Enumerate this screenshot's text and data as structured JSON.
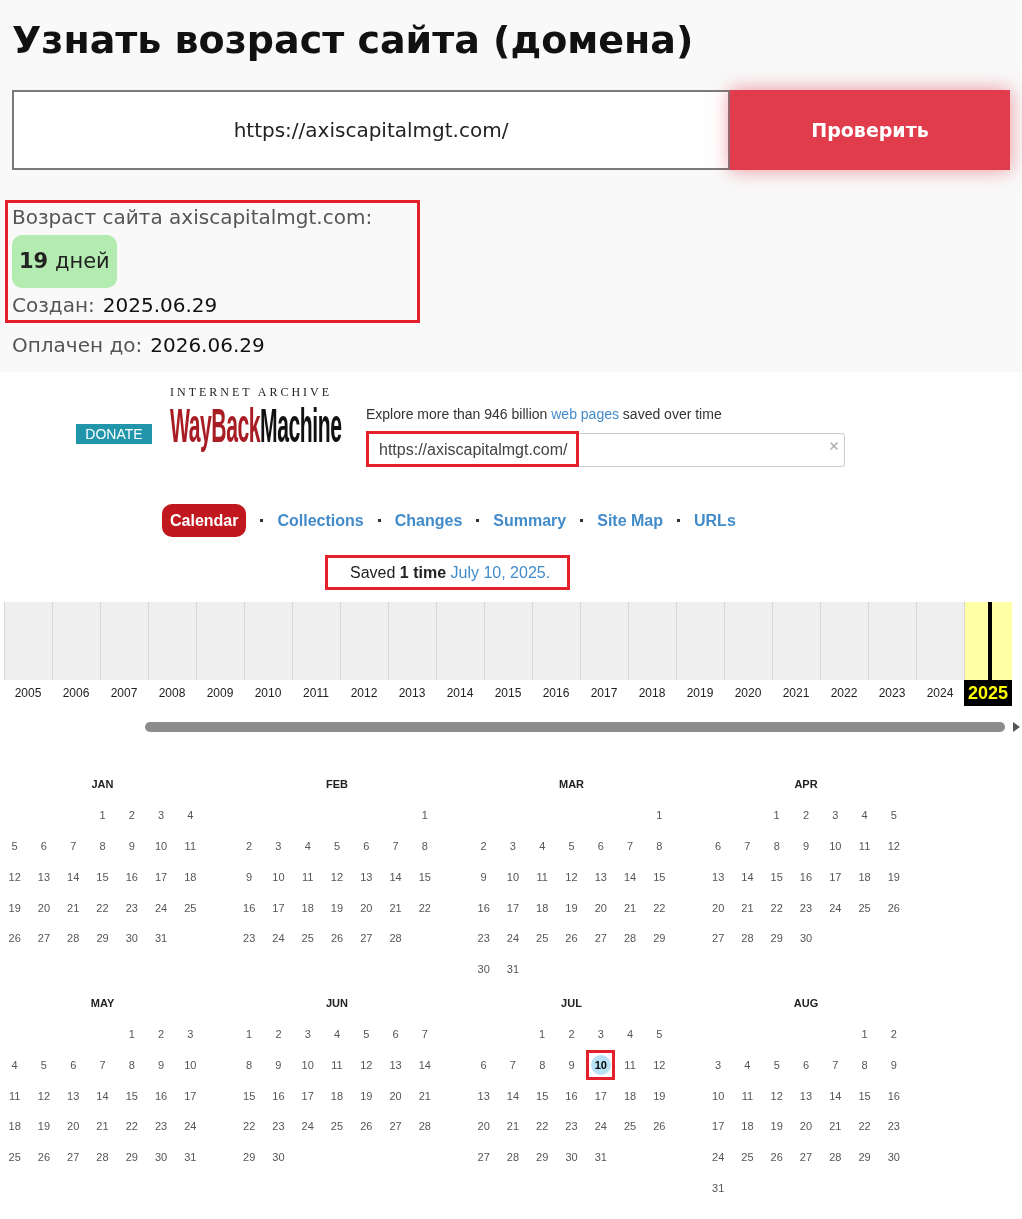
{
  "title": "Узнать возраст сайта (домена)",
  "check_form": {
    "value": "https://axiscapitalmgt.com/",
    "button": "Проверить"
  },
  "result": {
    "highlighted": true,
    "label": "Возраст сайта axiscapitalmgt.com:",
    "age": "**19** дней",
    "created_label": "Создан:",
    "created": "2025.06.29"
  },
  "paid": {
    "label": "Оплачен до:",
    "value": "2026.06.29"
  },
  "wayback": {
    "donate": "DONATE",
    "logo": {
      "caption": "INTERNET ARCHIVE",
      "word_1": "WayBack",
      "word_2": "Machine"
    },
    "tagline": {
      "before": "Explore more than 946 billion",
      "link": "web pages",
      "after": "saved over time"
    },
    "search": {
      "value": "https://axiscapitalmgt.com/",
      "highlighted": true
    },
    "nav": [
      {
        "label": "Calendar",
        "selected": true
      },
      {
        "label": "Collections",
        "selected": false
      },
      {
        "label": "Changes",
        "selected": false
      },
      {
        "label": "Summary",
        "selected": false
      },
      {
        "label": "Site Map",
        "selected": false
      },
      {
        "label": "URLs",
        "selected": false
      }
    ],
    "saved": {
      "summary": "Saved **1 time**",
      "date_link": "July 10, 2025.",
      "highlighted": true
    }
  },
  "timeline": {
    "years": [
      {
        "label": "2005",
        "selected": false,
        "has_captures": false
      },
      {
        "label": "2006",
        "selected": false,
        "has_captures": false
      },
      {
        "label": "2007",
        "selected": false,
        "has_captures": false
      },
      {
        "label": "2008",
        "selected": false,
        "has_captures": false
      },
      {
        "label": "2009",
        "selected": false,
        "has_captures": false
      },
      {
        "label": "2010",
        "selected": false,
        "has_captures": false
      },
      {
        "label": "2011",
        "selected": false,
        "has_captures": false
      },
      {
        "label": "2012",
        "selected": false,
        "has_captures": false
      },
      {
        "label": "2013",
        "selected": false,
        "has_captures": false
      },
      {
        "label": "2014",
        "selected": false,
        "has_captures": false
      },
      {
        "label": "2015",
        "selected": false,
        "has_captures": false
      },
      {
        "label": "2016",
        "selected": false,
        "has_captures": false
      },
      {
        "label": "2017",
        "selected": false,
        "has_captures": false
      },
      {
        "label": "2018",
        "selected": false,
        "has_captures": false
      },
      {
        "label": "2019",
        "selected": false,
        "has_captures": false
      },
      {
        "label": "2020",
        "selected": false,
        "has_captures": false
      },
      {
        "label": "2021",
        "selected": false,
        "has_captures": false
      },
      {
        "label": "2022",
        "selected": false,
        "has_captures": false
      },
      {
        "label": "2023",
        "selected": false,
        "has_captures": false
      },
      {
        "label": "2024",
        "selected": false,
        "has_captures": false
      },
      {
        "label": "2025",
        "selected": true,
        "has_captures": true
      }
    ]
  },
  "calendar": {
    "months": [
      {
        "name": "JAN",
        "weeks": [
          [
            {
              "day": "1",
              "saved": false,
              "highlighted": false
            },
            {
              "day": "2",
              "saved": false,
              "highlighted": false
            },
            {
              "day": "3",
              "saved": false,
              "highlighted": false
            },
            {
              "day": "4",
              "saved": false,
              "highlighted": false
            }
          ],
          [
            {
              "day": "5",
              "saved": false,
              "highlighted": false
            },
            {
              "day": "6",
              "saved": false,
              "highlighted": false
            },
            {
              "day": "7",
              "saved": false,
              "highlighted": false
            },
            {
              "day": "8",
              "saved": false,
              "highlighted": false
            },
            {
              "day": "9",
              "saved": false,
              "highlighted": false
            },
            {
              "day": "10",
              "saved": false,
              "highlighted": false
            },
            {
              "day": "11",
              "saved": false,
              "highlighted": false
            }
          ],
          [
            {
              "day": "12",
              "saved": false,
              "highlighted": false
            },
            {
              "day": "13",
              "saved": false,
              "highlighted": false
            },
            {
              "day": "14",
              "saved": false,
              "highlighted": false
            },
            {
              "day": "15",
              "saved": false,
              "highlighted": false
            },
            {
              "day": "16",
              "saved": false,
              "highlighted": false
            },
            {
              "day": "17",
              "saved": false,
              "highlighted": false
            },
            {
              "day": "18",
              "saved": false,
              "highlighted": false
            }
          ],
          [
            {
              "day": "19",
              "saved": false,
              "highlighted": false
            },
            {
              "day": "20",
              "saved": false,
              "highlighted": false
            },
            {
              "day": "21",
              "saved": false,
              "highlighted": false
            },
            {
              "day": "22",
              "saved": false,
              "highlighted": false
            },
            {
              "day": "23",
              "saved": false,
              "highlighted": false
            },
            {
              "day": "24",
              "saved": false,
              "highlighted": false
            },
            {
              "day": "25",
              "saved": false,
              "highlighted": false
            }
          ],
          [
            {
              "day": "26",
              "saved": false,
              "highlighted": false
            },
            {
              "day": "27",
              "saved": false,
              "highlighted": false
            },
            {
              "day": "28",
              "saved": false,
              "highlighted": false
            },
            {
              "day": "29",
              "saved": false,
              "highlighted": false
            },
            {
              "day": "30",
              "saved": false,
              "highlighted": false
            },
            {
              "day": "31",
              "saved": false,
              "highlighted": false
            }
          ]
        ]
      },
      {
        "name": "FEB",
        "weeks": [
          [
            {
              "day": "1",
              "saved": false,
              "highlighted": false
            }
          ],
          [
            {
              "day": "2",
              "saved": false,
              "highlighted": false
            },
            {
              "day": "3",
              "saved": false,
              "highlighted": false
            },
            {
              "day": "4",
              "saved": false,
              "highlighted": false
            },
            {
              "day": "5",
              "saved": false,
              "highlighted": false
            },
            {
              "day": "6",
              "saved": false,
              "highlighted": false
            },
            {
              "day": "7",
              "saved": false,
              "highlighted": false
            },
            {
              "day": "8",
              "saved": false,
              "highlighted": false
            }
          ],
          [
            {
              "day": "9",
              "saved": false,
              "highlighted": false
            },
            {
              "day": "10",
              "saved": false,
              "highlighted": false
            },
            {
              "day": "11",
              "saved": false,
              "highlighted": false
            },
            {
              "day": "12",
              "saved": false,
              "highlighted": false
            },
            {
              "day": "13",
              "saved": false,
              "highlighted": false
            },
            {
              "day": "14",
              "saved": false,
              "highlighted": false
            },
            {
              "day": "15",
              "saved": false,
              "highlighted": false
            }
          ],
          [
            {
              "day": "16",
              "saved": false,
              "highlighted": false
            },
            {
              "day": "17",
              "saved": false,
              "highlighted": false
            },
            {
              "day": "18",
              "saved": false,
              "highlighted": false
            },
            {
              "day": "19",
              "saved": false,
              "highlighted": false
            },
            {
              "day": "20",
              "saved": false,
              "highlighted": false
            },
            {
              "day": "21",
              "saved": false,
              "highlighted": false
            },
            {
              "day": "22",
              "saved": false,
              "highlighted": false
            }
          ],
          [
            {
              "day": "23",
              "saved": false,
              "highlighted": false
            },
            {
              "day": "24",
              "saved": false,
              "highlighted": false
            },
            {
              "day": "25",
              "saved": false,
              "highlighted": false
            },
            {
              "day": "26",
              "saved": false,
              "highlighted": false
            },
            {
              "day": "27",
              "saved": false,
              "highlighted": false
            },
            {
              "day": "28",
              "saved": false,
              "highlighted": false
            }
          ]
        ]
      },
      {
        "name": "MAR",
        "weeks": [
          [
            {
              "day": "1",
              "saved": false,
              "highlighted": false
            }
          ],
          [
            {
              "day": "2",
              "saved": false,
              "highlighted": false
            },
            {
              "day": "3",
              "saved": false,
              "highlighted": false
            },
            {
              "day": "4",
              "saved": false,
              "highlighted": false
            },
            {
              "day": "5",
              "saved": false,
              "highlighted": false
            },
            {
              "day": "6",
              "saved": false,
              "highlighted": false
            },
            {
              "day": "7",
              "saved": false,
              "highlighted": false
            },
            {
              "day": "8",
              "saved": false,
              "highlighted": false
            }
          ],
          [
            {
              "day": "9",
              "saved": false,
              "highlighted": false
            },
            {
              "day": "10",
              "saved": false,
              "highlighted": false
            },
            {
              "day": "11",
              "saved": false,
              "highlighted": false
            },
            {
              "day": "12",
              "saved": false,
              "highlighted": false
            },
            {
              "day": "13",
              "saved": false,
              "highlighted": false
            },
            {
              "day": "14",
              "saved": false,
              "highlighted": false
            },
            {
              "day": "15",
              "saved": false,
              "highlighted": false
            }
          ],
          [
            {
              "day": "16",
              "saved": false,
              "highlighted": false
            },
            {
              "day": "17",
              "saved": false,
              "highlighted": false
            },
            {
              "day": "18",
              "saved": false,
              "highlighted": false
            },
            {
              "day": "19",
              "saved": false,
              "highlighted": false
            },
            {
              "day": "20",
              "saved": false,
              "highlighted": false
            },
            {
              "day": "21",
              "saved": false,
              "highlighted": false
            },
            {
              "day": "22",
              "saved": false,
              "highlighted": false
            }
          ],
          [
            {
              "day": "23",
              "saved": false,
              "highlighted": false
            },
            {
              "day": "24",
              "saved": false,
              "highlighted": false
            },
            {
              "day": "25",
              "saved": false,
              "highlighted": false
            },
            {
              "day": "26",
              "saved": false,
              "highlighted": false
            },
            {
              "day": "27",
              "saved": false,
              "highlighted": false
            },
            {
              "day": "28",
              "saved": false,
              "highlighted": false
            },
            {
              "day": "29",
              "saved": false,
              "highlighted": false
            }
          ],
          [
            {
              "day": "30",
              "saved": false,
              "highlighted": false
            },
            {
              "day": "31",
              "saved": false,
              "highlighted": false
            }
          ]
        ]
      },
      {
        "name": "APR",
        "weeks": [
          [
            {
              "day": "1",
              "saved": false,
              "highlighted": false
            },
            {
              "day": "2",
              "saved": false,
              "highlighted": false
            },
            {
              "day": "3",
              "saved": false,
              "highlighted": false
            },
            {
              "day": "4",
              "saved": false,
              "highlighted": false
            },
            {
              "day": "5",
              "saved": false,
              "highlighted": false
            }
          ],
          [
            {
              "day": "6",
              "saved": false,
              "highlighted": false
            },
            {
              "day": "7",
              "saved": false,
              "highlighted": false
            },
            {
              "day": "8",
              "saved": false,
              "highlighted": false
            },
            {
              "day": "9",
              "saved": false,
              "highlighted": false
            },
            {
              "day": "10",
              "saved": false,
              "highlighted": false
            },
            {
              "day": "11",
              "saved": false,
              "highlighted": false
            },
            {
              "day": "12",
              "saved": false,
              "highlighted": false
            }
          ],
          [
            {
              "day": "13",
              "saved": false,
              "highlighted": false
            },
            {
              "day": "14",
              "saved": false,
              "highlighted": false
            },
            {
              "day": "15",
              "saved": false,
              "highlighted": false
            },
            {
              "day": "16",
              "saved": false,
              "highlighted": false
            },
            {
              "day": "17",
              "saved": false,
              "highlighted": false
            },
            {
              "day": "18",
              "saved": false,
              "highlighted": false
            },
            {
              "day": "19",
              "saved": false,
              "highlighted": false
            }
          ],
          [
            {
              "day": "20",
              "saved": false,
              "highlighted": false
            },
            {
              "day": "21",
              "saved": false,
              "highlighted": false
            },
            {
              "day": "22",
              "saved": false,
              "highlighted": false
            },
            {
              "day": "23",
              "saved": false,
              "highlighted": false
            },
            {
              "day": "24",
              "saved": false,
              "highlighted": false
            },
            {
              "day": "25",
              "saved": false,
              "highlighted": false
            },
            {
              "day": "26",
              "saved": false,
              "highlighted": false
            }
          ],
          [
            {
              "day": "27",
              "saved": false,
              "highlighted": false
            },
            {
              "day": "28",
              "saved": false,
              "highlighted": false
            },
            {
              "day": "29",
              "saved": false,
              "highlighted": false
            },
            {
              "day": "30",
              "saved": false,
              "highlighted": false
            }
          ]
        ]
      },
      {
        "name": "MAY",
        "weeks": [
          [
            {
              "day": "1",
              "saved": false,
              "highlighted": false
            },
            {
              "day": "2",
              "saved": false,
              "highlighted": false
            },
            {
              "day": "3",
              "saved": false,
              "highlighted": false
            }
          ],
          [
            {
              "day": "4",
              "saved": false,
              "highlighted": false
            },
            {
              "day": "5",
              "saved": false,
              "highlighted": false
            },
            {
              "day": "6",
              "saved": false,
              "highlighted": false
            },
            {
              "day": "7",
              "saved": false,
              "highlighted": false
            },
            {
              "day": "8",
              "saved": false,
              "highlighted": false
            },
            {
              "day": "9",
              "saved": false,
              "highlighted": false
            },
            {
              "day": "10",
              "saved": false,
              "highlighted": false
            }
          ],
          [
            {
              "day": "11",
              "saved": false,
              "highlighted": false
            },
            {
              "day": "12",
              "saved": false,
              "highlighted": false
            },
            {
              "day": "13",
              "saved": false,
              "highlighted": false
            },
            {
              "day": "14",
              "saved": false,
              "highlighted": false
            },
            {
              "day": "15",
              "saved": false,
              "highlighted": false
            },
            {
              "day": "16",
              "saved": false,
              "highlighted": false
            },
            {
              "day": "17",
              "saved": false,
              "highlighted": false
            }
          ],
          [
            {
              "day": "18",
              "saved": false,
              "highlighted": false
            },
            {
              "day": "19",
              "saved": false,
              "highlighted": false
            },
            {
              "day": "20",
              "saved": false,
              "highlighted": false
            },
            {
              "day": "21",
              "saved": false,
              "highlighted": false
            },
            {
              "day": "22",
              "saved": false,
              "highlighted": false
            },
            {
              "day": "23",
              "saved": false,
              "highlighted": false
            },
            {
              "day": "24",
              "saved": false,
              "highlighted": false
            }
          ],
          [
            {
              "day": "25",
              "saved": false,
              "highlighted": false
            },
            {
              "day": "26",
              "saved": false,
              "highlighted": false
            },
            {
              "day": "27",
              "saved": false,
              "highlighted": false
            },
            {
              "day": "28",
              "saved": false,
              "highlighted": false
            },
            {
              "day": "29",
              "saved": false,
              "highlighted": false
            },
            {
              "day": "30",
              "saved": false,
              "highlighted": false
            },
            {
              "day": "31",
              "saved": false,
              "highlighted": false
            }
          ]
        ]
      },
      {
        "name": "JUN",
        "weeks": [
          [
            {
              "day": "1",
              "saved": false,
              "highlighted": false
            },
            {
              "day": "2",
              "saved": false,
              "highlighted": false
            },
            {
              "day": "3",
              "saved": false,
              "highlighted": false
            },
            {
              "day": "4",
              "saved": false,
              "highlighted": false
            },
            {
              "day": "5",
              "saved": false,
              "highlighted": false
            },
            {
              "day": "6",
              "saved": false,
              "highlighted": false
            },
            {
              "day": "7",
              "saved": false,
              "highlighted": false
            }
          ],
          [
            {
              "day": "8",
              "saved": false,
              "highlighted": false
            },
            {
              "day": "9",
              "saved": false,
              "highlighted": false
            },
            {
              "day": "10",
              "saved": false,
              "highlighted": false
            },
            {
              "day": "11",
              "saved": false,
              "highlighted": false
            },
            {
              "day": "12",
              "saved": false,
              "highlighted": false
            },
            {
              "day": "13",
              "saved": false,
              "highlighted": false
            },
            {
              "day": "14",
              "saved": false,
              "highlighted": false
            }
          ],
          [
            {
              "day": "15",
              "saved": false,
              "highlighted": false
            },
            {
              "day": "16",
              "saved": false,
              "highlighted": false
            },
            {
              "day": "17",
              "saved": false,
              "highlighted": false
            },
            {
              "day": "18",
              "saved": false,
              "highlighted": false
            },
            {
              "day": "19",
              "saved": false,
              "highlighted": false
            },
            {
              "day": "20",
              "saved": false,
              "highlighted": false
            },
            {
              "day": "21",
              "saved": false,
              "highlighted": false
            }
          ],
          [
            {
              "day": "22",
              "saved": false,
              "highlighted": false
            },
            {
              "day": "23",
              "saved": false,
              "highlighted": false
            },
            {
              "day": "24",
              "saved": false,
              "highlighted": false
            },
            {
              "day": "25",
              "saved": false,
              "highlighted": false
            },
            {
              "day": "26",
              "saved": false,
              "highlighted": false
            },
            {
              "day": "27",
              "saved": false,
              "highlighted": false
            },
            {
              "day": "28",
              "saved": false,
              "highlighted": false
            }
          ],
          [
            {
              "day": "29",
              "saved": false,
              "highlighted": false
            },
            {
              "day": "30",
              "saved": false,
              "highlighted": false
            }
          ]
        ]
      },
      {
        "name": "JUL",
        "weeks": [
          [
            {
              "day": "1",
              "saved": false,
              "highlighted": false
            },
            {
              "day": "2",
              "saved": false,
              "highlighted": false
            },
            {
              "day": "3",
              "saved": false,
              "highlighted": false
            },
            {
              "day": "4",
              "saved": false,
              "highlighted": false
            },
            {
              "day": "5",
              "saved": false,
              "highlighted": false
            }
          ],
          [
            {
              "day": "6",
              "saved": false,
              "highlighted": false
            },
            {
              "day": "7",
              "saved": false,
              "highlighted": false
            },
            {
              "day": "8",
              "saved": false,
              "highlighted": false
            },
            {
              "day": "9",
              "saved": false,
              "highlighted": false
            },
            {
              "day": "10",
              "saved": true,
              "highlighted": true
            },
            {
              "day": "11",
              "saved": false,
              "highlighted": false
            },
            {
              "day": "12",
              "saved": false,
              "highlighted": false
            }
          ],
          [
            {
              "day": "13",
              "saved": false,
              "highlighted": false
            },
            {
              "day": "14",
              "saved": false,
              "highlighted": false
            },
            {
              "day": "15",
              "saved": false,
              "highlighted": false
            },
            {
              "day": "16",
              "saved": false,
              "highlighted": false
            },
            {
              "day": "17",
              "saved": false,
              "highlighted": false
            },
            {
              "day": "18",
              "saved": false,
              "highlighted": false
            },
            {
              "day": "19",
              "saved": false,
              "highlighted": false
            }
          ],
          [
            {
              "day": "20",
              "saved": false,
              "highlighted": false
            },
            {
              "day": "21",
              "saved": false,
              "highlighted": false
            },
            {
              "day": "22",
              "saved": false,
              "highlighted": false
            },
            {
              "day": "23",
              "saved": false,
              "highlighted": false
            },
            {
              "day": "24",
              "saved": false,
              "highlighted": false
            },
            {
              "day": "25",
              "saved": false,
              "highlighted": false
            },
            {
              "day": "26",
              "saved": false,
              "highlighted": false
            }
          ],
          [
            {
              "day": "27",
              "saved": false,
              "highlighted": false
            },
            {
              "day": "28",
              "saved": false,
              "highlighted": false
            },
            {
              "day": "29",
              "saved": false,
              "highlighted": false
            },
            {
              "day": "30",
              "saved": false,
              "highlighted": false
            },
            {
              "day": "31",
              "saved": false,
              "highlighted": false
            }
          ]
        ]
      },
      {
        "name": "AUG",
        "weeks": [
          [
            {
              "day": "1",
              "saved": false,
              "highlighted": false
            },
            {
              "day": "2",
              "saved": false,
              "highlighted": false
            }
          ],
          [
            {
              "day": "3",
              "saved": false,
              "highlighted": false
            },
            {
              "day": "4",
              "saved": false,
              "highlighted": false
            },
            {
              "day": "5",
              "saved": false,
              "highlighted": false
            },
            {
              "day": "6",
              "saved": false,
              "highlighted": false
            },
            {
              "day": "7",
              "saved": false,
              "highlighted": false
            },
            {
              "day": "8",
              "saved": false,
              "highlighted": false
            },
            {
              "day": "9",
              "saved": false,
              "highlighted": false
            }
          ],
          [
            {
              "day": "10",
              "saved": false,
              "highlighted": false
            },
            {
              "day": "11",
              "saved": false,
              "highlighted": false
            },
            {
              "day": "12",
              "saved": false,
              "highlighted": false
            },
            {
              "day": "13",
              "saved": false,
              "highlighted": false
            },
            {
              "day": "14",
              "saved": false,
              "highlighted": false
            },
            {
              "day": "15",
              "saved": false,
              "highlighted": false
            },
            {
              "day": "16",
              "saved": false,
              "highlighted": false
            }
          ],
          [
            {
              "day": "17",
              "saved": false,
              "highlighted": false
            },
            {
              "day": "18",
              "saved": false,
              "highlighted": false
            },
            {
              "day": "19",
              "saved": false,
              "highlighted": false
            },
            {
              "day": "20",
              "saved": false,
              "highlighted": false
            },
            {
              "day": "21",
              "saved": false,
              "highlighted": false
            },
            {
              "day": "22",
              "saved": false,
              "highlighted": false
            },
            {
              "day": "23",
              "saved": false,
              "highlighted": false
            }
          ],
          [
            {
              "day": "24",
              "saved": false,
              "highlighted": false
            },
            {
              "day": "25",
              "saved": false,
              "highlighted": false
            },
            {
              "day": "26",
              "saved": false,
              "highlighted": false
            },
            {
              "day": "27",
              "saved": false,
              "highlighted": false
            },
            {
              "day": "28",
              "saved": false,
              "highlighted": false
            },
            {
              "day": "29",
              "saved": false,
              "highlighted": false
            },
            {
              "day": "30",
              "saved": false,
              "highlighted": false
            }
          ],
          [
            {
              "day": "31",
              "saved": false,
              "highlighted": false
            }
          ]
        ]
      }
    ]
  }
}
